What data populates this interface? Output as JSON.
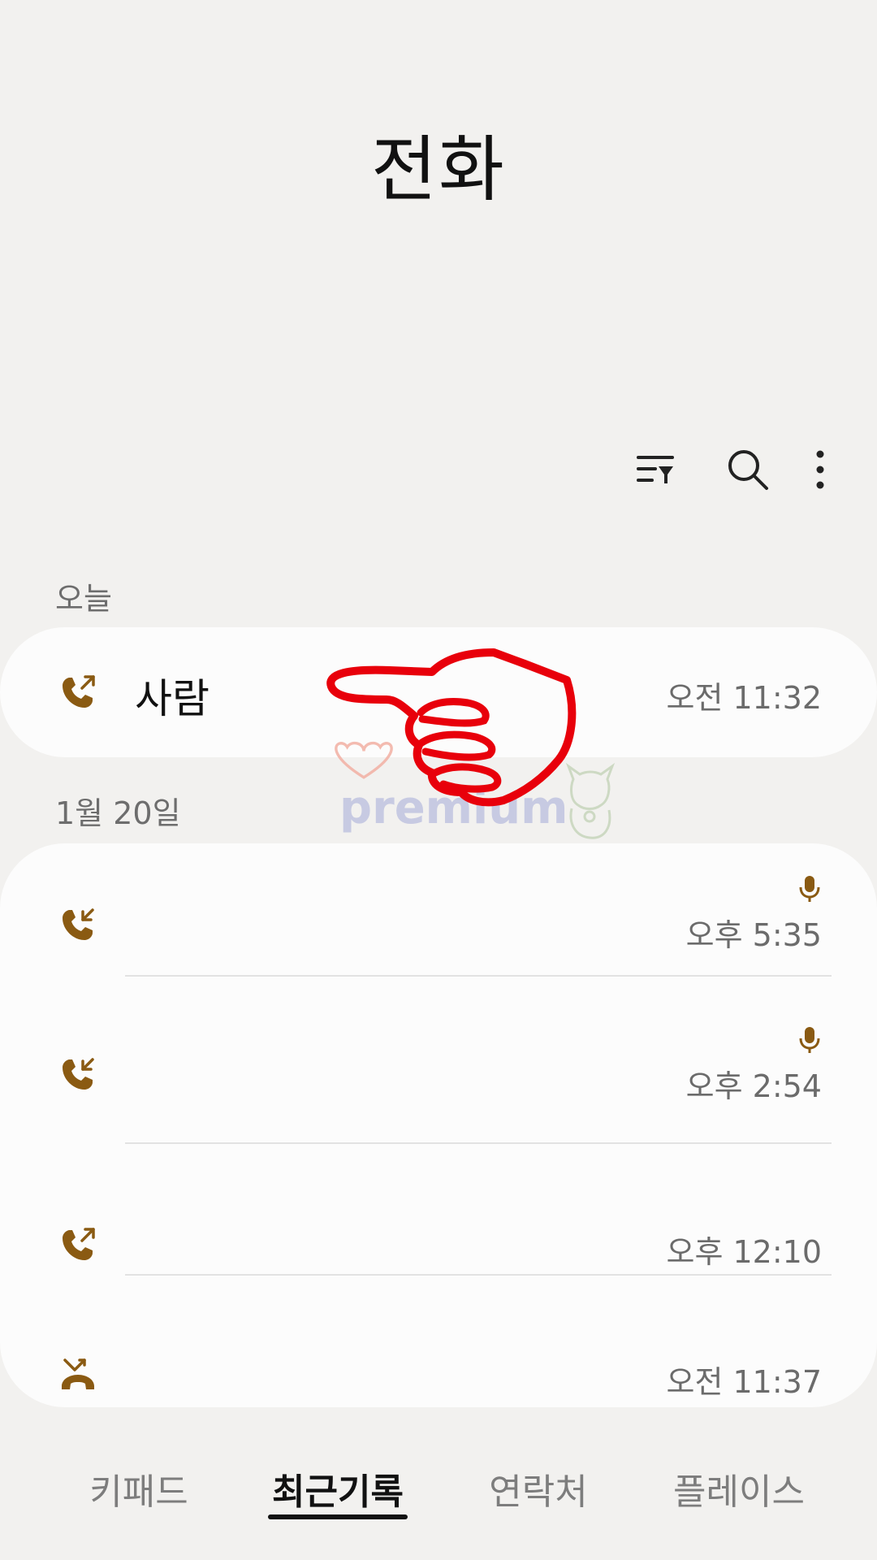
{
  "header": {
    "title": "전화"
  },
  "toolbar": {
    "icons": [
      "filter-icon",
      "search-icon",
      "more-vertical-icon"
    ]
  },
  "sections": [
    {
      "label": "오늘",
      "calls": [
        {
          "name": "사람",
          "time": "오전 11:32",
          "type": "outgoing",
          "recorded": false
        }
      ]
    },
    {
      "label": "1월 20일",
      "calls": [
        {
          "name": "",
          "time": "오후 5:35",
          "type": "incoming",
          "recorded": true
        },
        {
          "name": "",
          "time": "오후 2:54",
          "type": "incoming",
          "recorded": true
        },
        {
          "name": "",
          "time": "오후 12:10",
          "type": "outgoing",
          "recorded": false
        },
        {
          "name": "",
          "time": "오전 11:37",
          "type": "missed",
          "recorded": false
        }
      ]
    }
  ],
  "bottom_nav": {
    "tabs": [
      {
        "label": "키패드",
        "active": false
      },
      {
        "label": "최근기록",
        "active": true
      },
      {
        "label": "연락처",
        "active": false
      },
      {
        "label": "플레이스",
        "active": false
      }
    ]
  },
  "overlay": {
    "watermark_text": "premium"
  },
  "colors": {
    "background": "#f2f1ef",
    "card": "#fcfcfc",
    "call_icon": "#8a5a12",
    "pointer": "#e8000b"
  }
}
